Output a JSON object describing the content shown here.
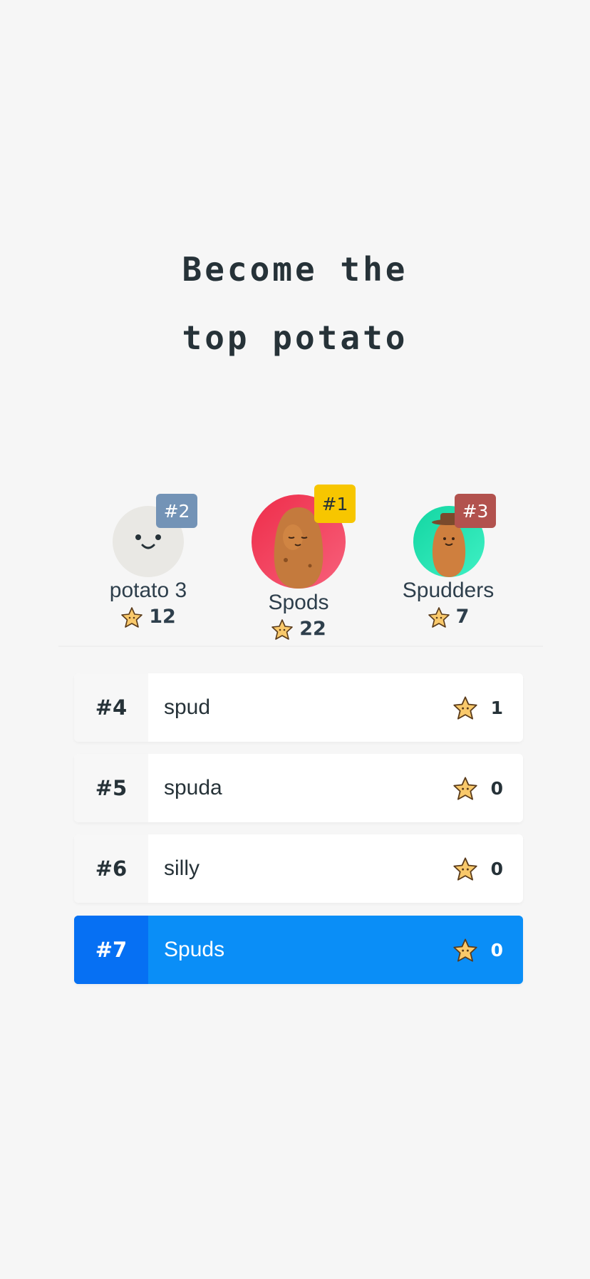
{
  "title": {
    "line1": "Become the",
    "line2": "top potato"
  },
  "podium": {
    "first": {
      "rank": "#1",
      "name": "Spods",
      "score": "22"
    },
    "second": {
      "rank": "#2",
      "name": "potato 3",
      "score": "12"
    },
    "third": {
      "rank": "#3",
      "name": "Spudders",
      "score": "7"
    }
  },
  "leaderboard": [
    {
      "rank": "#4",
      "name": "spud",
      "score": "1"
    },
    {
      "rank": "#5",
      "name": "spuda",
      "score": "0"
    },
    {
      "rank": "#6",
      "name": "silly",
      "score": "0"
    },
    {
      "rank": "#7",
      "name": "Spuds",
      "score": "0"
    }
  ],
  "colors": {
    "background": "#f6f6f6",
    "gold": "#f7c600",
    "silver": "#6f8fb4",
    "bronze": "#b2524e",
    "highlight": "#0a8ef7",
    "highlight_rank": "#0670f3"
  }
}
